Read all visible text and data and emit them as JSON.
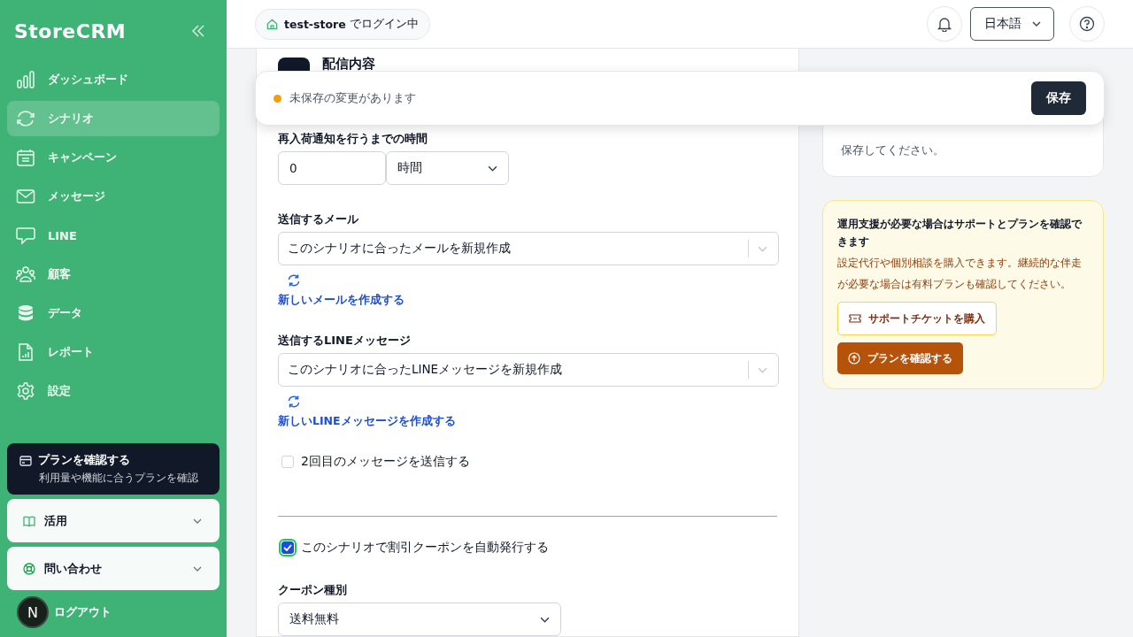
{
  "sidebar": {
    "logo": "StoreCRM",
    "items": [
      {
        "label": "ダッシュボード",
        "selected": false
      },
      {
        "label": "シナリオ",
        "selected": true
      },
      {
        "label": "キャンペーン",
        "selected": false
      },
      {
        "label": "メッセージ",
        "selected": false
      },
      {
        "label": "LINE",
        "selected": false
      },
      {
        "label": "顧客",
        "selected": false
      },
      {
        "label": "データ",
        "selected": false
      },
      {
        "label": "レポート",
        "selected": false
      },
      {
        "label": "設定",
        "selected": false
      }
    ],
    "plan_card": {
      "title": "プランを確認する",
      "subtitle": "利用量や機能に合うプランを確認"
    },
    "accordions": [
      {
        "label": "活用",
        "expanded": false
      },
      {
        "label": "問い合わせ",
        "expanded": false
      }
    ],
    "avatar": "N",
    "logout": "ログアウト"
  },
  "topbar": {
    "store": "test-store",
    "store_suffix": "でログイン中",
    "language": "日本語"
  },
  "unsaved_bar": {
    "message": "未保存の変更があります",
    "button": "保存"
  },
  "section": {
    "title": "配信内容"
  },
  "form": [
    {
      "kind": "number_unit",
      "label": "再入荷通知を行うまでの時間",
      "value": "0",
      "unit": "時間"
    },
    {
      "kind": "select",
      "label": "送信するメール",
      "value": "このシナリオに合ったメールを新規作成",
      "link": "新しいメールを作成する"
    },
    {
      "kind": "select",
      "label": "送信するLINEメッセージ",
      "value": "このシナリオに合ったLINEメッセージを新規作成",
      "link": "新しいLINEメッセージを作成する"
    },
    {
      "kind": "checkbox",
      "label": "2回目のメッセージを送信する",
      "checked": false
    },
    {
      "kind": "divider"
    },
    {
      "kind": "checkbox",
      "label": "このシナリオで割引クーポンを自動発行する",
      "checked": true
    },
    {
      "kind": "short_select",
      "label": "クーポン種別",
      "value": "送料無料"
    }
  ],
  "info_card": {
    "text": "保存してください。"
  },
  "support_card": {
    "title": "運用支援が必要な場合はサポートとプランを確認できます",
    "body": "設定代行や個別相談を購入できます。継続的な伴走が必要な場合は有料プランも確認してください。",
    "ticket_button": "サポートチケットを購入",
    "plan_button": "プランを確認する"
  }
}
